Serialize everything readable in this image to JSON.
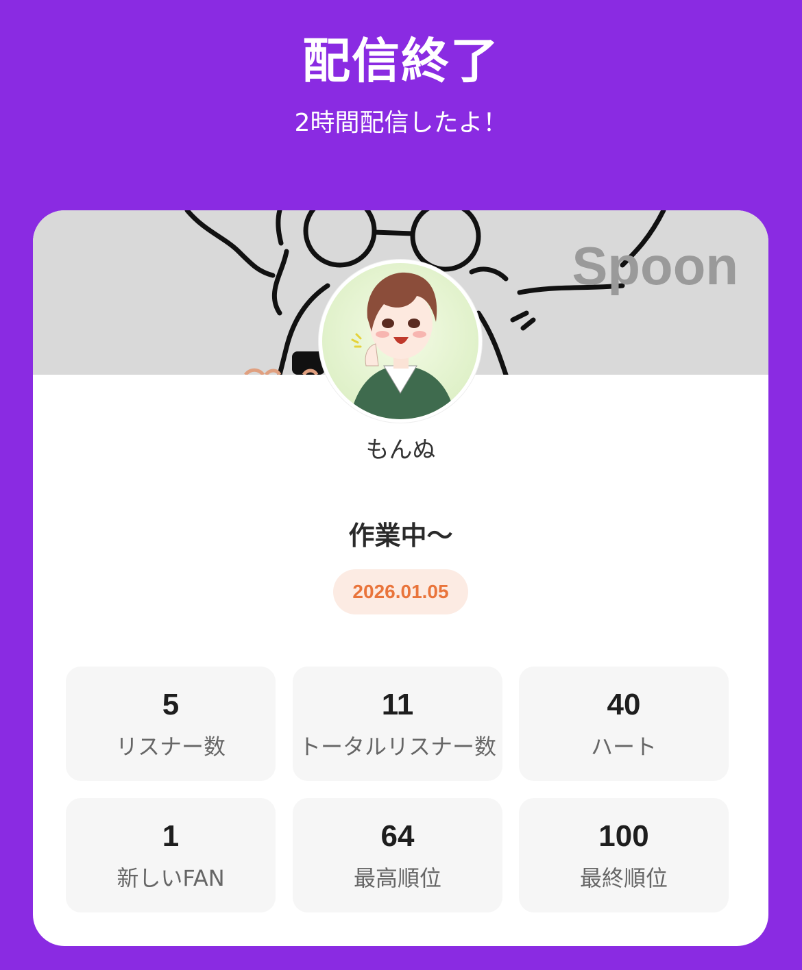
{
  "header": {
    "title": "配信終了",
    "subtitle": "2時間配信したよ！"
  },
  "card": {
    "watermark": "Spoon",
    "username": "もんぬ",
    "live_title": "作業中〜",
    "date": "2026.01.05"
  },
  "stats": [
    {
      "value": "5",
      "label": "リスナー数"
    },
    {
      "value": "11",
      "label": "トータルリスナー数"
    },
    {
      "value": "40",
      "label": "ハート"
    },
    {
      "value": "1",
      "label": "新しいFAN"
    },
    {
      "value": "64",
      "label": "最高順位"
    },
    {
      "value": "100",
      "label": "最終順位"
    }
  ],
  "colors": {
    "background": "#8a2be2",
    "card": "#ffffff",
    "badge_bg": "#fcebe3",
    "badge_text": "#e9743b",
    "stat_bg": "#f6f6f6"
  }
}
